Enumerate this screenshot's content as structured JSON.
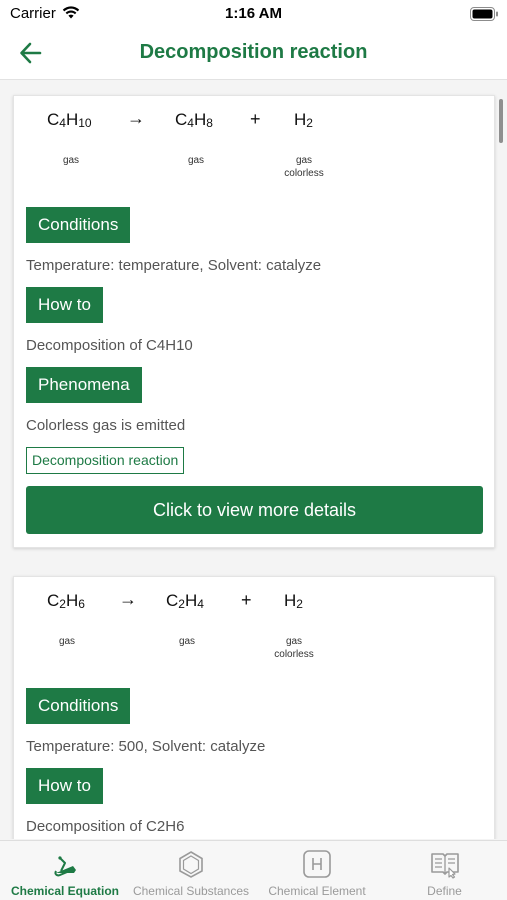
{
  "status_bar": {
    "carrier": "Carrier",
    "time": "1:16 AM"
  },
  "header": {
    "title": "Decomposition reaction",
    "back_icon": "arrow-left-icon"
  },
  "colors": {
    "accent": "#1e7a45",
    "text_muted": "#555555",
    "tab_inactive": "#9a9a9a"
  },
  "reactions": [
    {
      "reactant": {
        "base": "C4H10",
        "parts": [
          [
            "C",
            ""
          ],
          [
            "H",
            "4"
          ],
          [
            "",
            "10"
          ]
        ]
      },
      "product1": {
        "base": "C4H8"
      },
      "product2": {
        "base": "H2"
      },
      "arrow": "→",
      "plus": "+",
      "reactant_state": "gas",
      "product1_state": "gas",
      "product2_state_1": "gas",
      "product2_state_2": "colorless",
      "conditions_label": "Conditions",
      "conditions_text": "Temperature: temperature, Solvent: catalyze",
      "howto_label": "How to",
      "howto_text": "Decomposition of C4H10",
      "phenomena_label": "Phenomena",
      "phenomena_text": "Colorless gas is emitted",
      "reaction_type": "Decomposition reaction",
      "details_button": "Click to view more details"
    },
    {
      "arrow": "→",
      "plus": "+",
      "reactant_state": "gas",
      "product1_state": "gas",
      "product2_state_1": "gas",
      "product2_state_2": "colorless",
      "conditions_label": "Conditions",
      "conditions_text": "Temperature: 500, Solvent: catalyze",
      "howto_label": "How to",
      "howto_text": "Decomposition of C2H6"
    }
  ],
  "tabs": [
    {
      "label": "Chemical Equation",
      "icon": "flask-icon",
      "active": true
    },
    {
      "label": "Chemical Substances",
      "icon": "hexagon-icon",
      "active": false
    },
    {
      "label": "Chemical Element",
      "icon": "element-h-icon",
      "active": false
    },
    {
      "label": "Define",
      "icon": "book-icon",
      "active": false
    }
  ]
}
